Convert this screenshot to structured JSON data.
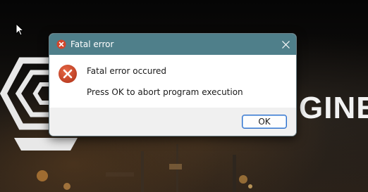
{
  "background": {
    "engine_text": "GINE",
    "colors": {
      "backdrop": "#0d0c0b",
      "text": "#f2f2f2"
    }
  },
  "dialog": {
    "title": "Fatal error",
    "message": "Fatal error occured",
    "detail": "Press OK to abort program execution",
    "ok_label": "OK",
    "icons": {
      "title": "error-icon",
      "message": "error-icon",
      "close": "close-icon"
    },
    "colors": {
      "titlebar": "#4f7f8a",
      "error": "#c8452a",
      "ok_border": "#2b6cc9"
    }
  }
}
